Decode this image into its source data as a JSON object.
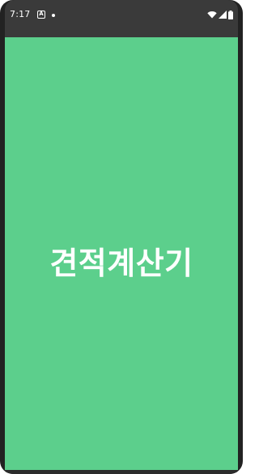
{
  "status_bar": {
    "time": "7:17",
    "notification_icon_letter": "A",
    "icons": [
      "notification-icon",
      "dot-icon",
      "wifi-icon",
      "signal-icon",
      "battery-icon"
    ]
  },
  "splash": {
    "title": "견적계산기",
    "background_color": "#5ccf8c",
    "text_color": "#ffffff"
  }
}
